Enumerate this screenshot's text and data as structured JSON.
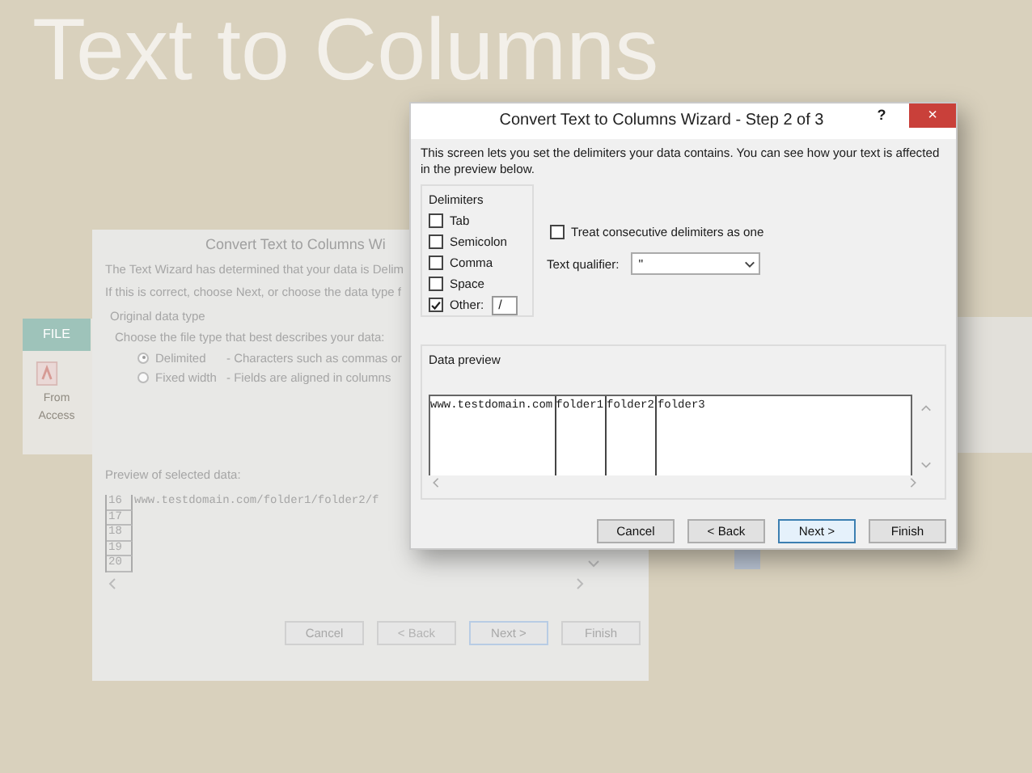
{
  "slide_title": "Text to Columns",
  "ribbon": {
    "tab": "FILE",
    "button": "From Access"
  },
  "back_dialog": {
    "title": "Convert Text to Columns Wi",
    "intro": [
      "The Text Wizard has determined that your data is Delim",
      "If this is correct, choose Next, or choose the data type f"
    ],
    "group_label": "Original data type",
    "prompt": "Choose the file type that best describes your data:",
    "options": [
      {
        "label": "Delimited",
        "selected": true,
        "description": "- Characters such as commas or"
      },
      {
        "label": "Fixed width",
        "selected": false,
        "description": "- Fields are aligned in columns"
      }
    ],
    "preview_label": "Preview of selected data:",
    "preview_rows": [
      {
        "number": "16",
        "text": "www.testdomain.com/folder1/folder2/f"
      },
      {
        "number": "17"
      },
      {
        "number": "18"
      },
      {
        "number": "19"
      },
      {
        "number": "20"
      }
    ],
    "buttons": [
      {
        "label": "Cancel",
        "disabled": false,
        "default": false
      },
      {
        "label": "< Back",
        "disabled": true,
        "default": false
      },
      {
        "label": "Next >",
        "disabled": false,
        "default": true
      },
      {
        "label": "Finish",
        "disabled": false,
        "default": false
      }
    ]
  },
  "front_dialog": {
    "title": "Convert Text to Columns Wizard - Step 2 of 3",
    "help": "?",
    "close": "×",
    "intro": "This screen lets you set the delimiters your data contains.  You can see how your text is affected in the preview below.",
    "delimiters_label": "Delimiters",
    "delimiters": [
      {
        "label": "Tab",
        "checked": false
      },
      {
        "label": "Semicolon",
        "checked": false
      },
      {
        "label": "Comma",
        "checked": false
      },
      {
        "label": "Space",
        "checked": false
      },
      {
        "label": "Other:",
        "checked": true,
        "value": "/"
      }
    ],
    "consecutive": {
      "label": "Treat consecutive delimiters as one",
      "checked": false
    },
    "qualifier": {
      "label": "Text qualifier:",
      "value": "\""
    },
    "preview_label": "Data preview",
    "preview_columns": [
      "www.testdomain.com",
      "folder1",
      "folder2",
      "folder3"
    ],
    "buttons": [
      {
        "label": "Cancel",
        "disabled": false,
        "default": false
      },
      {
        "label": "< Back",
        "disabled": false,
        "default": false
      },
      {
        "label": "Next >",
        "disabled": false,
        "default": true
      },
      {
        "label": "Finish",
        "disabled": false,
        "default": false
      }
    ]
  }
}
